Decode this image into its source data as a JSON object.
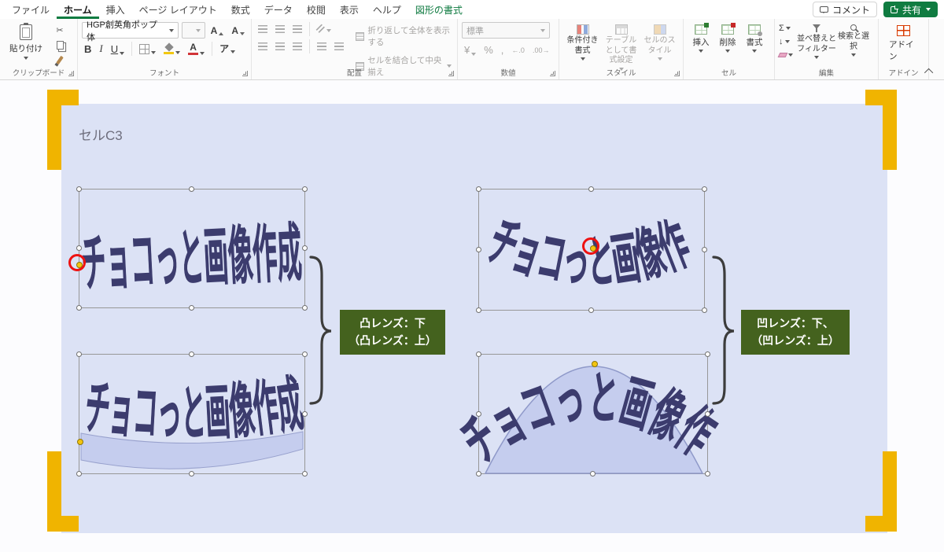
{
  "menubar": {
    "items": [
      "ファイル",
      "ホーム",
      "挿入",
      "ページ レイアウト",
      "数式",
      "データ",
      "校閲",
      "表示",
      "ヘルプ",
      "図形の書式"
    ],
    "comment": "コメント",
    "share": "共有"
  },
  "ribbon": {
    "paste": "貼り付け",
    "font_name": "HGP創英角ポップ体",
    "wrap_text": "折り返して全体を表示する",
    "merge_center": "セルを結合して中央揃え",
    "number_format": "標準",
    "conditional": "条件付き書式",
    "table_style": "テーブルとして書式設定",
    "cell_styles": "セルのスタイル",
    "insert": "挿入",
    "delete": "削除",
    "format": "書式",
    "sort_filter": "並べ替えとフィルター",
    "find_select": "検索と選択",
    "addins_btn": "アドイン",
    "groups": {
      "clipboard": "クリップボード",
      "font": "フォント",
      "alignment": "配置",
      "number": "数値",
      "styles": "スタイル",
      "cells": "セル",
      "editing": "編集",
      "addins": "アドイン"
    },
    "icons": {
      "scissors": "✂",
      "bold": "B",
      "italic": "I",
      "underline": "U",
      "font_size": "A",
      "autosum": "Σ",
      "fill_arrow": "↓",
      "currency": "¥",
      "percent": "%",
      "comma": ",",
      "decimal_increase": "←.0",
      "decimal_decrease": ".00→",
      "ruby": "ア",
      "font_color": "A"
    }
  },
  "canvas": {
    "cell_ref": "セルC3",
    "wordart": "チョコっと画像作成",
    "left_label": {
      "line1": "凸レンズ：下",
      "line2": "（凸レンズ：上）"
    },
    "right_label": {
      "line1": "凹レンズ：下、",
      "line2": "（凹レンズ：上）"
    }
  },
  "colors": {
    "accent_green": "#107c41",
    "sheet_fill": "#dce2f5",
    "shape_fill": "#c5cdee",
    "wordart_color": "#3c3c6e",
    "callout_bg": "#44621e",
    "highlight_red": "#ee1111",
    "corner_yellow": "#f0b400"
  }
}
